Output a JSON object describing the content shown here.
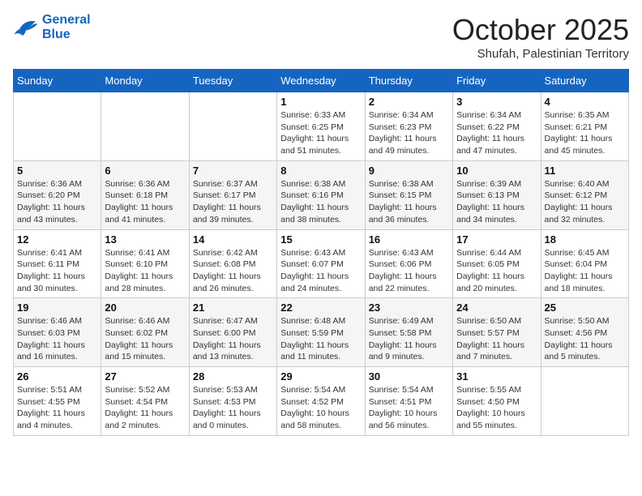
{
  "header": {
    "logo_line1": "General",
    "logo_line2": "Blue",
    "month_title": "October 2025",
    "location": "Shufah, Palestinian Territory"
  },
  "weekdays": [
    "Sunday",
    "Monday",
    "Tuesday",
    "Wednesday",
    "Thursday",
    "Friday",
    "Saturday"
  ],
  "weeks": [
    [
      {
        "day": "",
        "info": ""
      },
      {
        "day": "",
        "info": ""
      },
      {
        "day": "",
        "info": ""
      },
      {
        "day": "1",
        "info": "Sunrise: 6:33 AM\nSunset: 6:25 PM\nDaylight: 11 hours\nand 51 minutes."
      },
      {
        "day": "2",
        "info": "Sunrise: 6:34 AM\nSunset: 6:23 PM\nDaylight: 11 hours\nand 49 minutes."
      },
      {
        "day": "3",
        "info": "Sunrise: 6:34 AM\nSunset: 6:22 PM\nDaylight: 11 hours\nand 47 minutes."
      },
      {
        "day": "4",
        "info": "Sunrise: 6:35 AM\nSunset: 6:21 PM\nDaylight: 11 hours\nand 45 minutes."
      }
    ],
    [
      {
        "day": "5",
        "info": "Sunrise: 6:36 AM\nSunset: 6:20 PM\nDaylight: 11 hours\nand 43 minutes."
      },
      {
        "day": "6",
        "info": "Sunrise: 6:36 AM\nSunset: 6:18 PM\nDaylight: 11 hours\nand 41 minutes."
      },
      {
        "day": "7",
        "info": "Sunrise: 6:37 AM\nSunset: 6:17 PM\nDaylight: 11 hours\nand 39 minutes."
      },
      {
        "day": "8",
        "info": "Sunrise: 6:38 AM\nSunset: 6:16 PM\nDaylight: 11 hours\nand 38 minutes."
      },
      {
        "day": "9",
        "info": "Sunrise: 6:38 AM\nSunset: 6:15 PM\nDaylight: 11 hours\nand 36 minutes."
      },
      {
        "day": "10",
        "info": "Sunrise: 6:39 AM\nSunset: 6:13 PM\nDaylight: 11 hours\nand 34 minutes."
      },
      {
        "day": "11",
        "info": "Sunrise: 6:40 AM\nSunset: 6:12 PM\nDaylight: 11 hours\nand 32 minutes."
      }
    ],
    [
      {
        "day": "12",
        "info": "Sunrise: 6:41 AM\nSunset: 6:11 PM\nDaylight: 11 hours\nand 30 minutes."
      },
      {
        "day": "13",
        "info": "Sunrise: 6:41 AM\nSunset: 6:10 PM\nDaylight: 11 hours\nand 28 minutes."
      },
      {
        "day": "14",
        "info": "Sunrise: 6:42 AM\nSunset: 6:08 PM\nDaylight: 11 hours\nand 26 minutes."
      },
      {
        "day": "15",
        "info": "Sunrise: 6:43 AM\nSunset: 6:07 PM\nDaylight: 11 hours\nand 24 minutes."
      },
      {
        "day": "16",
        "info": "Sunrise: 6:43 AM\nSunset: 6:06 PM\nDaylight: 11 hours\nand 22 minutes."
      },
      {
        "day": "17",
        "info": "Sunrise: 6:44 AM\nSunset: 6:05 PM\nDaylight: 11 hours\nand 20 minutes."
      },
      {
        "day": "18",
        "info": "Sunrise: 6:45 AM\nSunset: 6:04 PM\nDaylight: 11 hours\nand 18 minutes."
      }
    ],
    [
      {
        "day": "19",
        "info": "Sunrise: 6:46 AM\nSunset: 6:03 PM\nDaylight: 11 hours\nand 16 minutes."
      },
      {
        "day": "20",
        "info": "Sunrise: 6:46 AM\nSunset: 6:02 PM\nDaylight: 11 hours\nand 15 minutes."
      },
      {
        "day": "21",
        "info": "Sunrise: 6:47 AM\nSunset: 6:00 PM\nDaylight: 11 hours\nand 13 minutes."
      },
      {
        "day": "22",
        "info": "Sunrise: 6:48 AM\nSunset: 5:59 PM\nDaylight: 11 hours\nand 11 minutes."
      },
      {
        "day": "23",
        "info": "Sunrise: 6:49 AM\nSunset: 5:58 PM\nDaylight: 11 hours\nand 9 minutes."
      },
      {
        "day": "24",
        "info": "Sunrise: 6:50 AM\nSunset: 5:57 PM\nDaylight: 11 hours\nand 7 minutes."
      },
      {
        "day": "25",
        "info": "Sunrise: 5:50 AM\nSunset: 4:56 PM\nDaylight: 11 hours\nand 5 minutes."
      }
    ],
    [
      {
        "day": "26",
        "info": "Sunrise: 5:51 AM\nSunset: 4:55 PM\nDaylight: 11 hours\nand 4 minutes."
      },
      {
        "day": "27",
        "info": "Sunrise: 5:52 AM\nSunset: 4:54 PM\nDaylight: 11 hours\nand 2 minutes."
      },
      {
        "day": "28",
        "info": "Sunrise: 5:53 AM\nSunset: 4:53 PM\nDaylight: 11 hours\nand 0 minutes."
      },
      {
        "day": "29",
        "info": "Sunrise: 5:54 AM\nSunset: 4:52 PM\nDaylight: 10 hours\nand 58 minutes."
      },
      {
        "day": "30",
        "info": "Sunrise: 5:54 AM\nSunset: 4:51 PM\nDaylight: 10 hours\nand 56 minutes."
      },
      {
        "day": "31",
        "info": "Sunrise: 5:55 AM\nSunset: 4:50 PM\nDaylight: 10 hours\nand 55 minutes."
      },
      {
        "day": "",
        "info": ""
      }
    ]
  ]
}
